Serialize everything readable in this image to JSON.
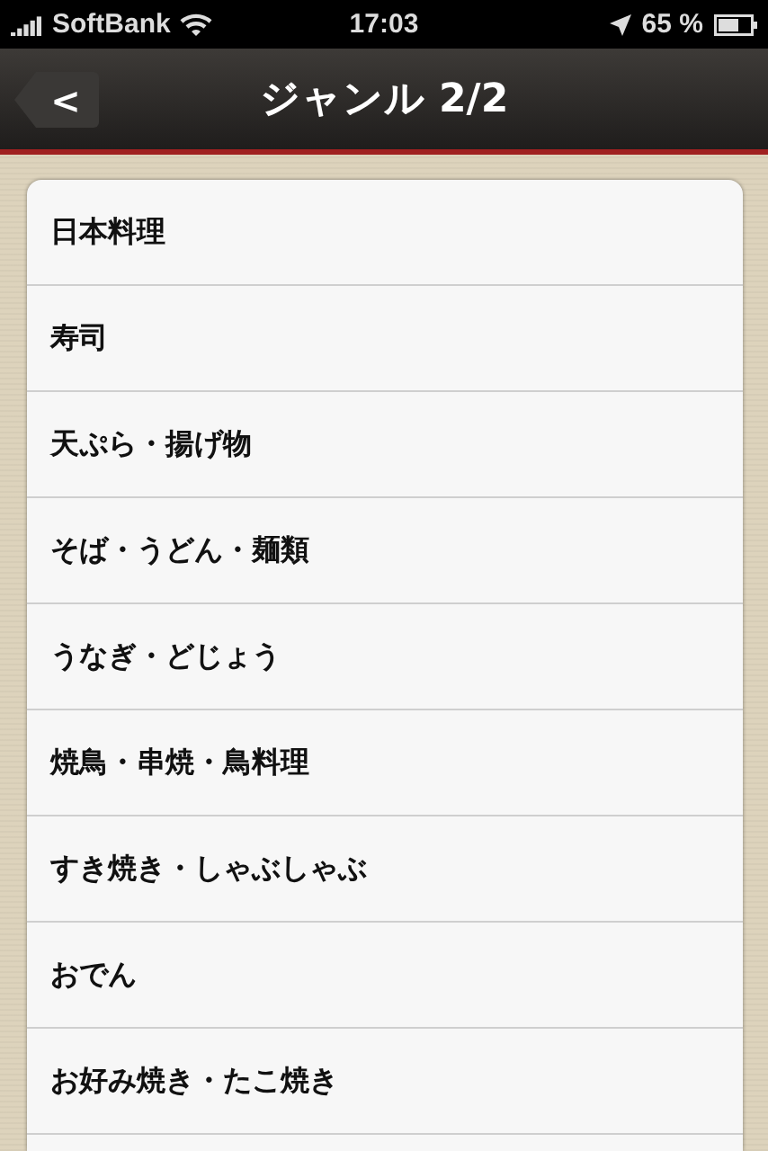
{
  "status_bar": {
    "carrier": "SoftBank",
    "time": "17:03",
    "battery": "65 %"
  },
  "nav_bar": {
    "back": "<",
    "title": "ジャンル 2/2"
  },
  "genres": [
    {
      "label": "日本料理"
    },
    {
      "label": "寿司"
    },
    {
      "label": "天ぷら・揚げ物"
    },
    {
      "label": "そば・うどん・麺類"
    },
    {
      "label": "うなぎ・どじょう"
    },
    {
      "label": "焼鳥・串焼・鳥料理"
    },
    {
      "label": "すき焼き・しゃぶしゃぶ"
    },
    {
      "label": "おでん"
    },
    {
      "label": "お好み焼き・たこ焼き"
    }
  ]
}
